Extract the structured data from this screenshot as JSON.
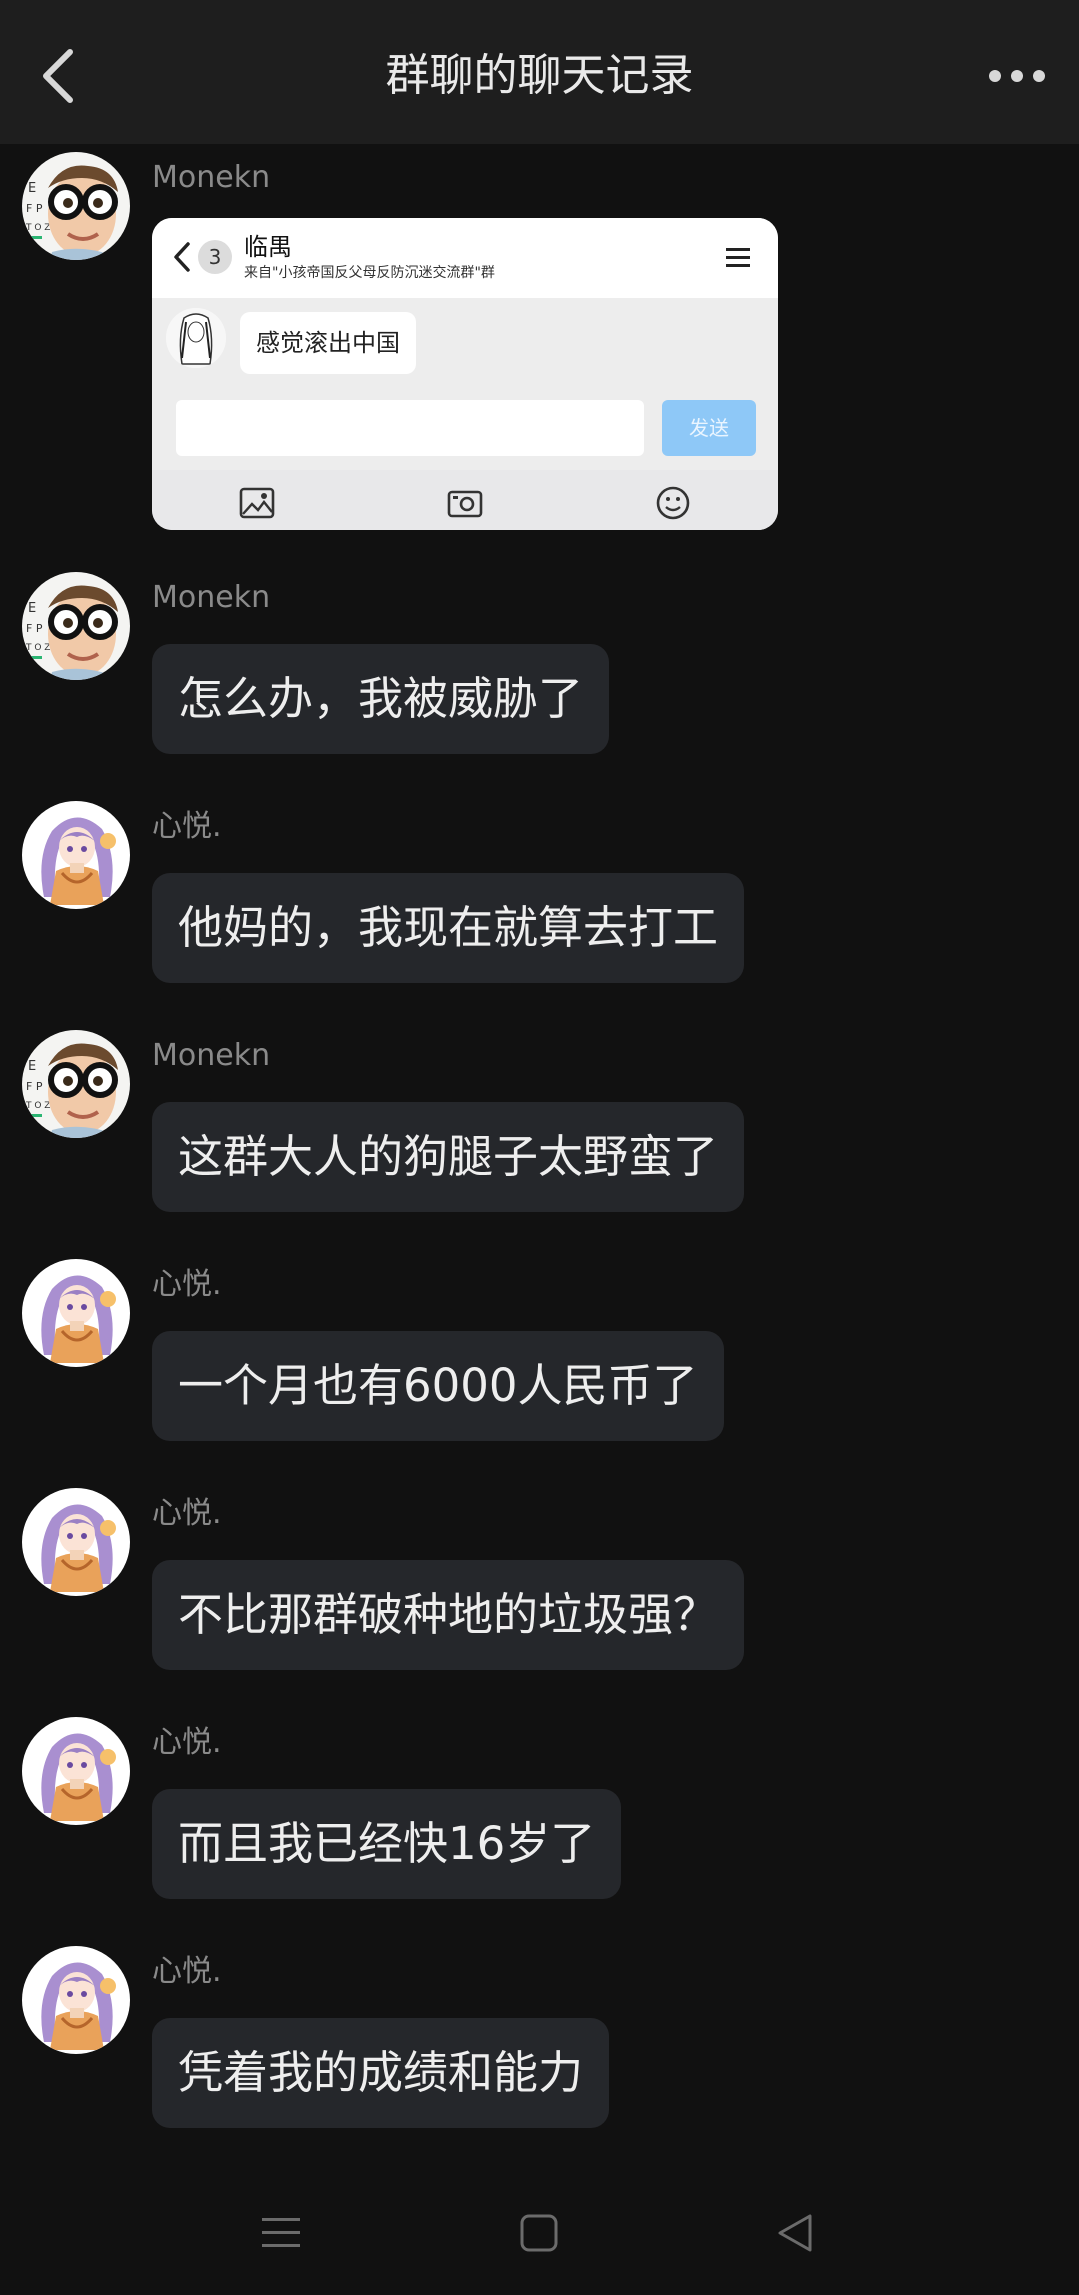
{
  "header": {
    "title": "群聊的聊天记录",
    "back_icon": "chevron-left-icon",
    "more_icon": "more-horizontal-icon"
  },
  "messages": [
    {
      "sender": "Monekn",
      "avatar": "glasses-boy-avatar",
      "type": "image",
      "card": {
        "badge": "3",
        "title": "临禺",
        "subtitle": "来自\"小孩帝国反父母反防沉迷交流群\"群",
        "message": "感觉滚出中国",
        "send_label": "发送"
      }
    },
    {
      "sender": "Monekn",
      "avatar": "glasses-boy-avatar",
      "text": "怎么办，我被威胁了"
    },
    {
      "sender": "心悦.",
      "avatar": "anime-girl-avatar",
      "text": "他妈的，我现在就算去打工"
    },
    {
      "sender": "Monekn",
      "avatar": "glasses-boy-avatar",
      "text": "这群大人的狗腿子太野蛮了"
    },
    {
      "sender": "心悦.",
      "avatar": "anime-girl-avatar",
      "text": "一个月也有6000人民币了"
    },
    {
      "sender": "心悦.",
      "avatar": "anime-girl-avatar",
      "text": "不比那群破种地的垃圾强？"
    },
    {
      "sender": "心悦.",
      "avatar": "anime-girl-avatar",
      "text": "而且我已经快16岁了"
    },
    {
      "sender": "心悦.",
      "avatar": "anime-girl-avatar",
      "text": "凭着我的成绩和能力"
    }
  ],
  "colors": {
    "background": "#111111",
    "header": "#1e1e1e",
    "bubble": "#25272b",
    "send_button": "#8ec8f7"
  }
}
